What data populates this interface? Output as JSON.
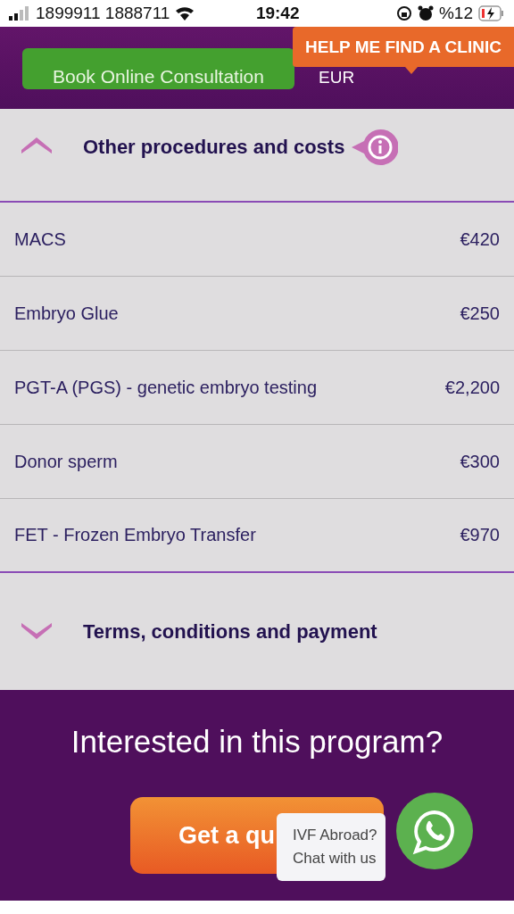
{
  "status_bar": {
    "carrier": "1899911 1888711",
    "time": "19:42",
    "battery": "%12"
  },
  "header": {
    "book_button": "Book Online Consultation",
    "currency": "EUR",
    "help_button": "HELP ME FIND A CLINIC"
  },
  "sections": [
    {
      "title": "Other procedures and costs",
      "expanded": true,
      "info": true,
      "rows": [
        {
          "name": "MACS",
          "price": "€420"
        },
        {
          "name": "Embryo Glue",
          "price": "€250"
        },
        {
          "name": "PGT-A (PGS) - genetic embryo testing",
          "price": "€2,200"
        },
        {
          "name": "Donor sperm",
          "price": "€300"
        },
        {
          "name": "FET - Frozen Embryo Transfer",
          "price": "€970"
        }
      ]
    },
    {
      "title": "Terms, conditions and payment",
      "expanded": false
    }
  ],
  "cta": {
    "heading": "Interested in this program?",
    "button": "Get a qu"
  },
  "chat": {
    "line1": "IVF Abroad?",
    "line2": "Chat with us"
  }
}
